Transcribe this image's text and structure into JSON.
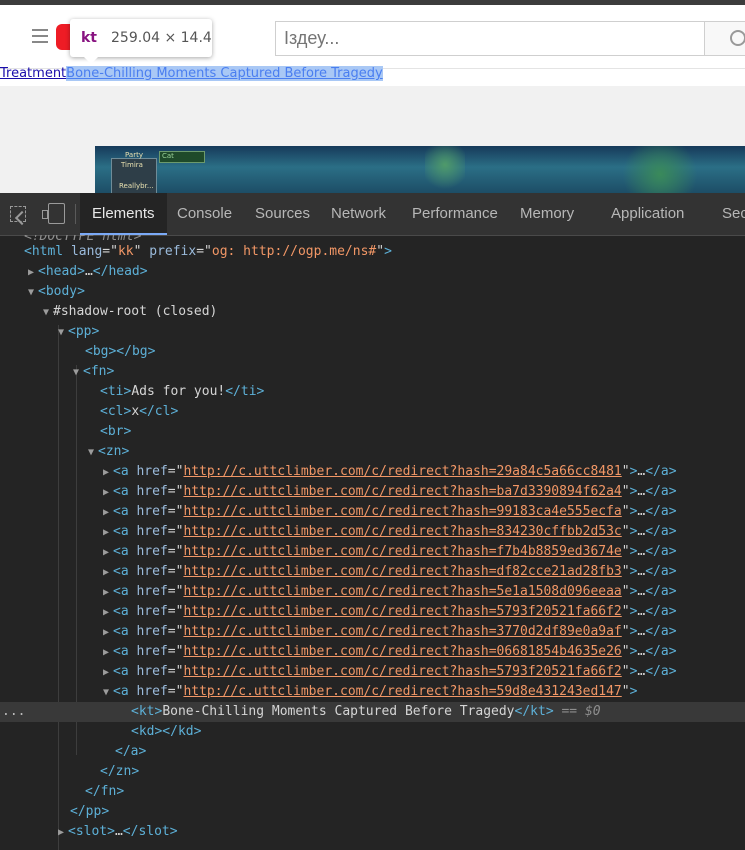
{
  "page": {
    "search_placeholder": "Іздеу...",
    "link_treatment": "Treatment",
    "link_headline": "Bone-Chilling Moments Captured Before Tragedy",
    "tooltip_tag": "kt",
    "tooltip_dims": "259.04 × 14.4",
    "game_party": "Party",
    "game_name1": "Timira",
    "game_name2": "Reallybr...",
    "game_chat": "Cat"
  },
  "devtools": {
    "tabs": [
      "Elements",
      "Console",
      "Sources",
      "Network",
      "Performance",
      "Memory",
      "Application",
      "Sec"
    ],
    "active_tab": "Elements",
    "colors": {
      "tag": "#5db0d7",
      "attr_name": "#9bbbdc",
      "attr_value": "#f29766",
      "selected_row": "#393939"
    }
  },
  "dom": {
    "doctype": "<!DOCTYPE html>",
    "html_open": "html",
    "html_lang_name": "lang",
    "html_lang_value": "kk",
    "html_prefix_name": "prefix",
    "html_prefix_value": "og: http://ogp.me/ns#",
    "head": "head",
    "body": "body",
    "shadow_root": "#shadow-root (closed)",
    "pp": "pp",
    "bg": "bg",
    "fn": "fn",
    "ti": "ti",
    "ti_text": "Ads for you!",
    "cl": "cl",
    "cl_text": "x",
    "br": "br",
    "zn": "zn",
    "href_attr": "href",
    "ellipsis": "…",
    "links": [
      "http://c.uttclimber.com/c/redirect?hash=29a84c5a66cc8481",
      "http://c.uttclimber.com/c/redirect?hash=ba7d3390894f62a4",
      "http://c.uttclimber.com/c/redirect?hash=99183ca4e555ecfa",
      "http://c.uttclimber.com/c/redirect?hash=834230cffbb2d53c",
      "http://c.uttclimber.com/c/redirect?hash=f7b4b8859ed3674e",
      "http://c.uttclimber.com/c/redirect?hash=df82cce21ad28fb3",
      "http://c.uttclimber.com/c/redirect?hash=5e1a1508d096eeaa",
      "http://c.uttclimber.com/c/redirect?hash=5793f20521fa66f2",
      "http://c.uttclimber.com/c/redirect?hash=3770d2df89e0a9af",
      "http://c.uttclimber.com/c/redirect?hash=06681854b4635e26",
      "http://c.uttclimber.com/c/redirect?hash=5793f20521fa66f2",
      "http://c.uttclimber.com/c/redirect?hash=59d8e431243ed147"
    ],
    "kt": "kt",
    "kt_text": "Bone-Chilling Moments Captured Before Tragedy",
    "selected_marker": "== $0",
    "row_menu": "...",
    "kd": "kd",
    "a_close": "a",
    "slot": "slot"
  }
}
